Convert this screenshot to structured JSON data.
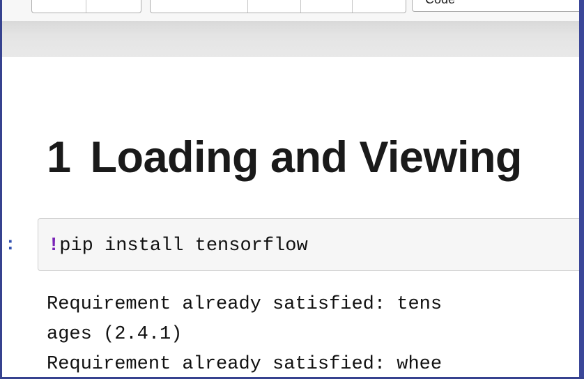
{
  "toolbar": {
    "cell_type": "Code"
  },
  "notebook": {
    "heading": {
      "number": "1",
      "title": "Loading and Viewing"
    },
    "cells": [
      {
        "prompt": ":",
        "magic": "!",
        "command": "pip install tensorflow",
        "output_lines": [
          "Requirement already satisfied: tens",
          "ages (2.4.1)",
          "Requirement already satisfied: whee"
        ]
      }
    ]
  },
  "colors": {
    "frame_border": "#36428f",
    "prompt": "#3150b0",
    "magic_bang": "#7a24b7",
    "code_background": "#f6f6f6"
  }
}
